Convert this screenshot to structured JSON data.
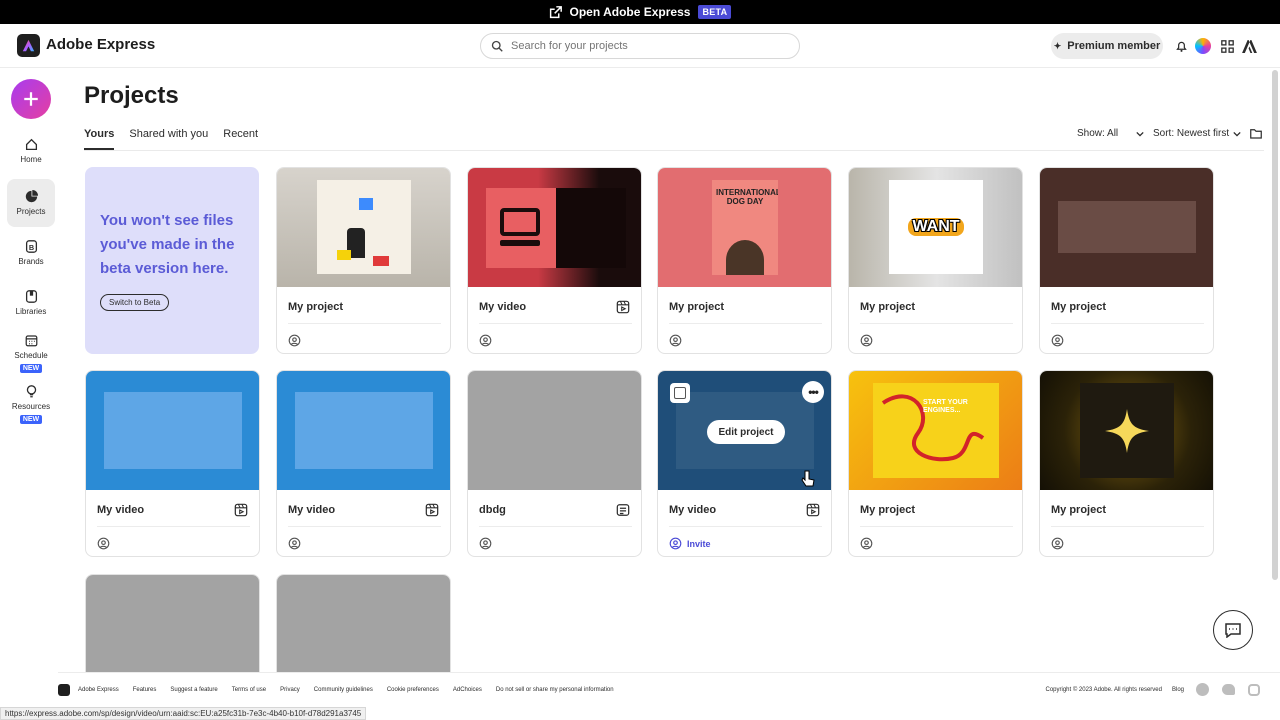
{
  "banner": {
    "text": "Open Adobe Express",
    "badge": "BETA"
  },
  "header": {
    "app_name": "Adobe Express",
    "search_placeholder": "Search for your projects",
    "premium_label": "Premium member"
  },
  "sidebar": {
    "items": [
      {
        "label": "Home"
      },
      {
        "label": "Projects"
      },
      {
        "label": "Brands"
      },
      {
        "label": "Libraries"
      },
      {
        "label": "Schedule",
        "badge": "NEW"
      },
      {
        "label": "Resources",
        "badge": "NEW"
      }
    ]
  },
  "page": {
    "title": "Projects"
  },
  "tabs": [
    {
      "label": "Yours"
    },
    {
      "label": "Shared with you"
    },
    {
      "label": "Recent"
    }
  ],
  "filters": {
    "show": "Show: All",
    "sort": "Sort: Newest first"
  },
  "promo": {
    "text": "You won't see files you've made in the beta version here.",
    "button": "Switch to Beta"
  },
  "thumb_texts": {
    "dog_day": "INTERNATIONAL DOG DAY",
    "want": "WANT",
    "engines": "START YOUR ENGINES..."
  },
  "cards": [
    {
      "name": "My project",
      "type": "project",
      "thumb_color": "#c9c6c0"
    },
    {
      "name": "My video",
      "type": "video",
      "thumb_color": "#c93a44"
    },
    {
      "name": "My project",
      "type": "project",
      "thumb_color": "#e26d70"
    },
    {
      "name": "My project",
      "type": "project",
      "thumb_color": "#cfcfcf"
    },
    {
      "name": "My project",
      "type": "project",
      "thumb_color": "#4a2e28"
    },
    {
      "name": "My video",
      "type": "video",
      "thumb_color": "#2b8bd5"
    },
    {
      "name": "My video",
      "type": "video",
      "thumb_color": "#2b8bd5"
    },
    {
      "name": "dbdg",
      "type": "doc",
      "thumb_color": "#a3a3a3"
    },
    {
      "name": "My video",
      "type": "video",
      "thumb_color": "#1f4e79",
      "hover_action": "Edit project",
      "invite": "Invite"
    },
    {
      "name": "My project",
      "type": "project",
      "thumb_color": "#f2a61c"
    },
    {
      "name": "My project",
      "type": "project",
      "thumb_color": "#1f1a10"
    },
    {
      "name": "",
      "type": "",
      "thumb_color": "#a3a3a3"
    },
    {
      "name": "",
      "type": "",
      "thumb_color": "#a3a3a3"
    }
  ],
  "footer": {
    "brand": "Adobe Express",
    "links": [
      "Features",
      "Suggest a feature",
      "Terms of use",
      "Privacy",
      "Community guidelines",
      "Cookie preferences",
      "AdChoices",
      "Do not sell or share my personal information"
    ],
    "copyright": "Copyright © 2023 Adobe. All rights reserved",
    "blog": "Blog"
  },
  "status_url": "https://express.adobe.com/sp/design/video/urn:aaid:sc:EU:a25fc31b-7e3c-4b40-b10f-d78d291a3745"
}
